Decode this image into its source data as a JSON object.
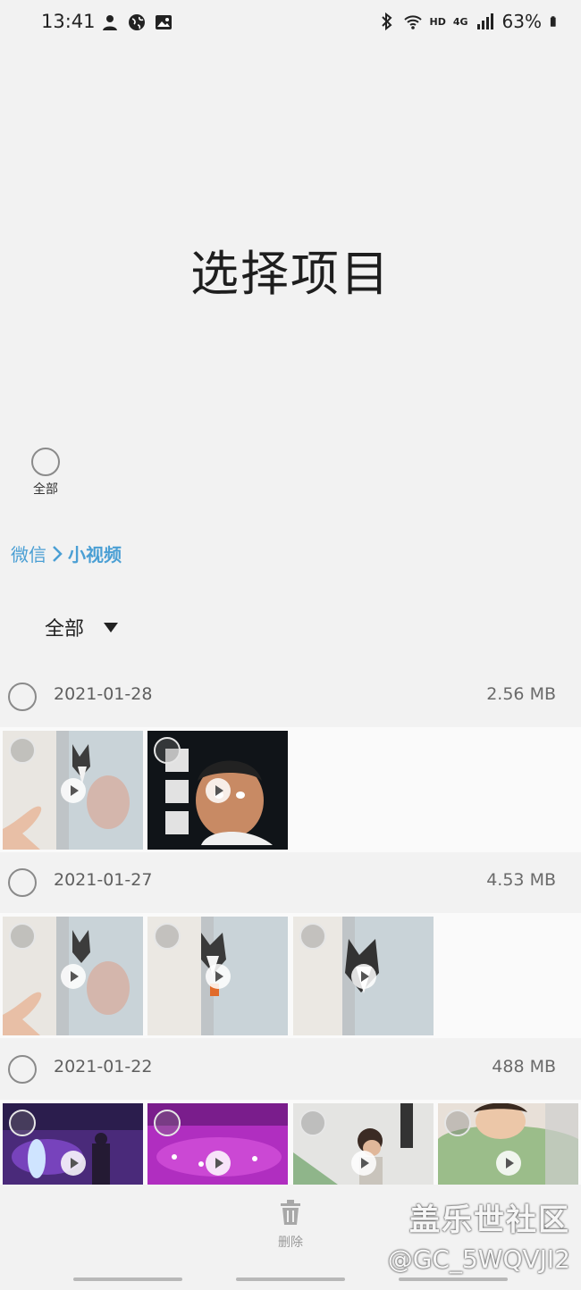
{
  "status_bar": {
    "time": "13:41",
    "left_icons": [
      "user-icon",
      "globe-icon",
      "image-icon"
    ],
    "right_icons": [
      "bluetooth-icon",
      "wifi-icon",
      "hd-icon",
      "signal-icon",
      "battery-icon"
    ],
    "network": "4G",
    "hd": "HD",
    "battery": "63%"
  },
  "title": "选择项目",
  "select_all_label": "全部",
  "breadcrumb": {
    "parent": "微信",
    "current": "小视频"
  },
  "filter": {
    "selected": "全部"
  },
  "groups": [
    {
      "date": "2021-01-28",
      "size": "2.56 MB",
      "thumbnails": [
        {
          "kind": "husky-peek",
          "icon": "video-play-icon"
        },
        {
          "kind": "meme-man",
          "icon": "video-play-icon"
        }
      ]
    },
    {
      "date": "2021-01-27",
      "size": "4.53 MB",
      "thumbnails": [
        {
          "kind": "husky-peek",
          "icon": "video-play-icon"
        },
        {
          "kind": "husky-peek",
          "icon": "video-play-icon"
        },
        {
          "kind": "husky-peek",
          "icon": "video-play-icon"
        }
      ]
    },
    {
      "date": "2021-01-22",
      "size": "488 MB",
      "thumbnails": [
        {
          "kind": "stage-purple",
          "icon": "video-play-icon"
        },
        {
          "kind": "stage-pink",
          "icon": "video-play-icon"
        },
        {
          "kind": "child-room",
          "icon": "video-play-icon"
        },
        {
          "kind": "baby-green",
          "icon": "video-play-icon"
        }
      ]
    }
  ],
  "bottom_bar": {
    "delete_label": "删除",
    "delete_icon": "trash-icon"
  },
  "watermark": {
    "title": "盖乐世社区",
    "user": "@GC_5WQVJI2"
  },
  "colors": {
    "background": "#f2f2f2",
    "link": "#4a9fd4",
    "text_secondary": "#5f5f5f"
  }
}
